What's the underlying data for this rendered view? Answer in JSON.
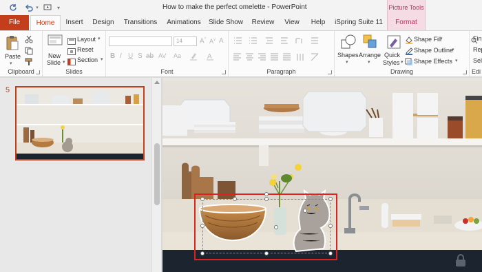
{
  "window": {
    "title": "How to make the perfect omelette  -  PowerPoint",
    "context_group": "Picture Tools",
    "quick_access": [
      "autosave-icon",
      "undo-icon",
      "redo-icon",
      "start-from-beginning-icon",
      "customize-icon"
    ]
  },
  "tabs": [
    {
      "label": "File"
    },
    {
      "label": "Home"
    },
    {
      "label": "Insert"
    },
    {
      "label": "Design"
    },
    {
      "label": "Transitions"
    },
    {
      "label": "Animations"
    },
    {
      "label": "Slide Show"
    },
    {
      "label": "Review"
    },
    {
      "label": "View"
    },
    {
      "label": "Help"
    },
    {
      "label": "iSpring Suite 11"
    },
    {
      "label": "Format"
    }
  ],
  "active_tab": "Home",
  "ribbon": {
    "clipboard": {
      "label": "Clipboard",
      "paste": "Paste"
    },
    "slides": {
      "label": "Slides",
      "new_slide_1": "New",
      "new_slide_2": "Slide",
      "layout": "Layout",
      "reset": "Reset",
      "section": "Section"
    },
    "font": {
      "label": "Font",
      "font_name": "",
      "font_size": "14"
    },
    "paragraph": {
      "label": "Paragraph"
    },
    "drawing": {
      "label": "Drawing",
      "shapes": "Shapes",
      "arrange": "Arrange",
      "quick_styles_1": "Quick",
      "quick_styles_2": "Styles",
      "shape_fill": "Shape Fill",
      "shape_outline": "Shape Outline",
      "shape_effects": "Shape Effects"
    },
    "editing": {
      "label": "Edi",
      "find": "Fin",
      "replace": "Rep",
      "select": "Sel"
    }
  },
  "thumbnails": {
    "current_slide_number": "5"
  },
  "colors": {
    "accent": "#c43e1c",
    "context_tab": "#b4335e",
    "selection": "#d22222"
  }
}
